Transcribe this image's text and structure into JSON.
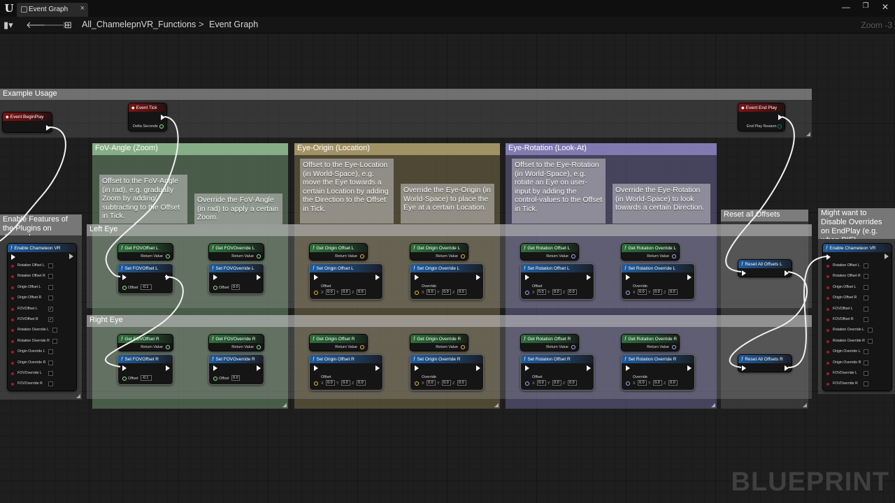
{
  "window": {
    "tab_label": "Event Graph",
    "close_glyph": "×",
    "minimize_glyph": "—",
    "maximize_glyph": "❐",
    "close_window_glyph": "✕"
  },
  "toolbar": {
    "breadcrumb_root": "All_ChamelepnVR_Functions",
    "breadcrumb_sep": ">",
    "breadcrumb_current": "Event Graph",
    "zoom_label": "Zoom -3"
  },
  "watermark": "BLUEPRINT",
  "groups": {
    "example_usage": "Example Usage",
    "fov": "FoV-Angle (Zoom)",
    "origin": "Eye-Origin (Location)",
    "rotation": "Eye-Rotation (Look-At)",
    "left_eye": "Left Eye",
    "right_eye": "Right Eye",
    "reset": "Reset all Offsets",
    "enable_left": "Enable Features of the Plugins on demand",
    "enable_right": "Might want to Disable Overrides on EndPlay (e.g. when PIE)"
  },
  "notes": {
    "fov_offset": "Offset to the FoV-Angle (in rad), e.g. gradually Zoom by adding/ subtracting to the Offset in Tick.",
    "fov_override": "Override the FoV-Angle (in rad) to apply a certain Zoom.",
    "origin_offset": "Offset to the Eye-Location (in World-Space), e.g. move the Eye towards a certain Location by adding the Direction to the Offset in Tick.",
    "origin_override": "Override the Eye-Origin (in World-Space) to place the Eye at a certain Location.",
    "rotation_offset": "Offset to the Eye-Rotation (in World-Space), e.g. rotate an Eye on user-input by adding the control-values to the Offset in Tick.",
    "rotation_override": "Override the Eye-Rotation (in World-Space) to look towards a certain Direction."
  },
  "events": {
    "begin_play": "Event BeginPlay",
    "tick": "Event Tick",
    "delta_seconds": "Delta Seconds",
    "end_play": "Event End Play",
    "end_play_reason": "End Play Reason"
  },
  "enable_node": {
    "title": "Enable Chameleon VR",
    "pins": [
      "Rotation Offset L",
      "Rotation Offset R",
      "Origin Offset L",
      "Origin Offset R",
      "FOVOffset L",
      "FOVOffset R",
      "Rotation Override L",
      "Rotation Override R",
      "Origin Override L",
      "Origin Override R",
      "FOVOverride L",
      "FOVOverride R"
    ],
    "left_checked": [
      false,
      false,
      false,
      false,
      true,
      true,
      false,
      false,
      false,
      false,
      false,
      false
    ],
    "check_glyph": "✓"
  },
  "nodes": {
    "return_value": "Return Value",
    "offset": "Offset",
    "override": "Override",
    "x": "X",
    "y": "Y",
    "z": "Z",
    "zero": "0.0",
    "neg": "-0.1",
    "left": {
      "get_fov_offset": "Get FOVOffset L",
      "set_fov_offset": "Set FOVOffset L",
      "get_fov_override": "Get FOVOverride L",
      "set_fov_override": "Set FOVOverride L",
      "get_origin_offset": "Get Origin Offset L",
      "set_origin_offset": "Set Origin Offset L",
      "get_origin_override": "Get Origin Override L",
      "set_origin_override": "Set Origin Override L",
      "get_rot_offset": "Get Rotation Offset L",
      "set_rot_offset": "Set Rotation Offset L",
      "get_rot_override": "Get Rotation Override L",
      "set_rot_override": "Set Rotation Override L",
      "reset": "Reset All Offsets L"
    },
    "right": {
      "get_fov_offset": "Get FOVOffset R",
      "set_fov_offset": "Set FOVOffset R",
      "get_fov_override": "Get FOVOverride R",
      "set_fov_override": "Set FOVOverride R",
      "get_origin_offset": "Get Origin Offset R",
      "set_origin_offset": "Set Origin Offset R",
      "get_origin_override": "Get Origin Override R",
      "set_origin_override": "Set Origin Override R",
      "get_rot_offset": "Get Rotation Offset R",
      "set_rot_offset": "Set Rotation Offset R",
      "get_rot_override": "Get Rotation Override R",
      "set_rot_override": "Set Rotation Override R",
      "reset": "Reset All Offsets R"
    }
  },
  "colors": {
    "fov_group": "#7fa87f",
    "origin_group": "#a89a6a",
    "rotation_group": "#8a82b8",
    "float_pin": "#8cf08a",
    "vector_pin": "#f0c020",
    "rotator_pin": "#9fb0ff",
    "enum_pin": "#0a7c6c"
  },
  "icons": {
    "logo": "unreal-logo-icon",
    "back": "back-arrow-icon",
    "forward": "forward-arrow-icon",
    "graph": "graph-icon",
    "function": "function-icon",
    "event": "event-icon"
  }
}
